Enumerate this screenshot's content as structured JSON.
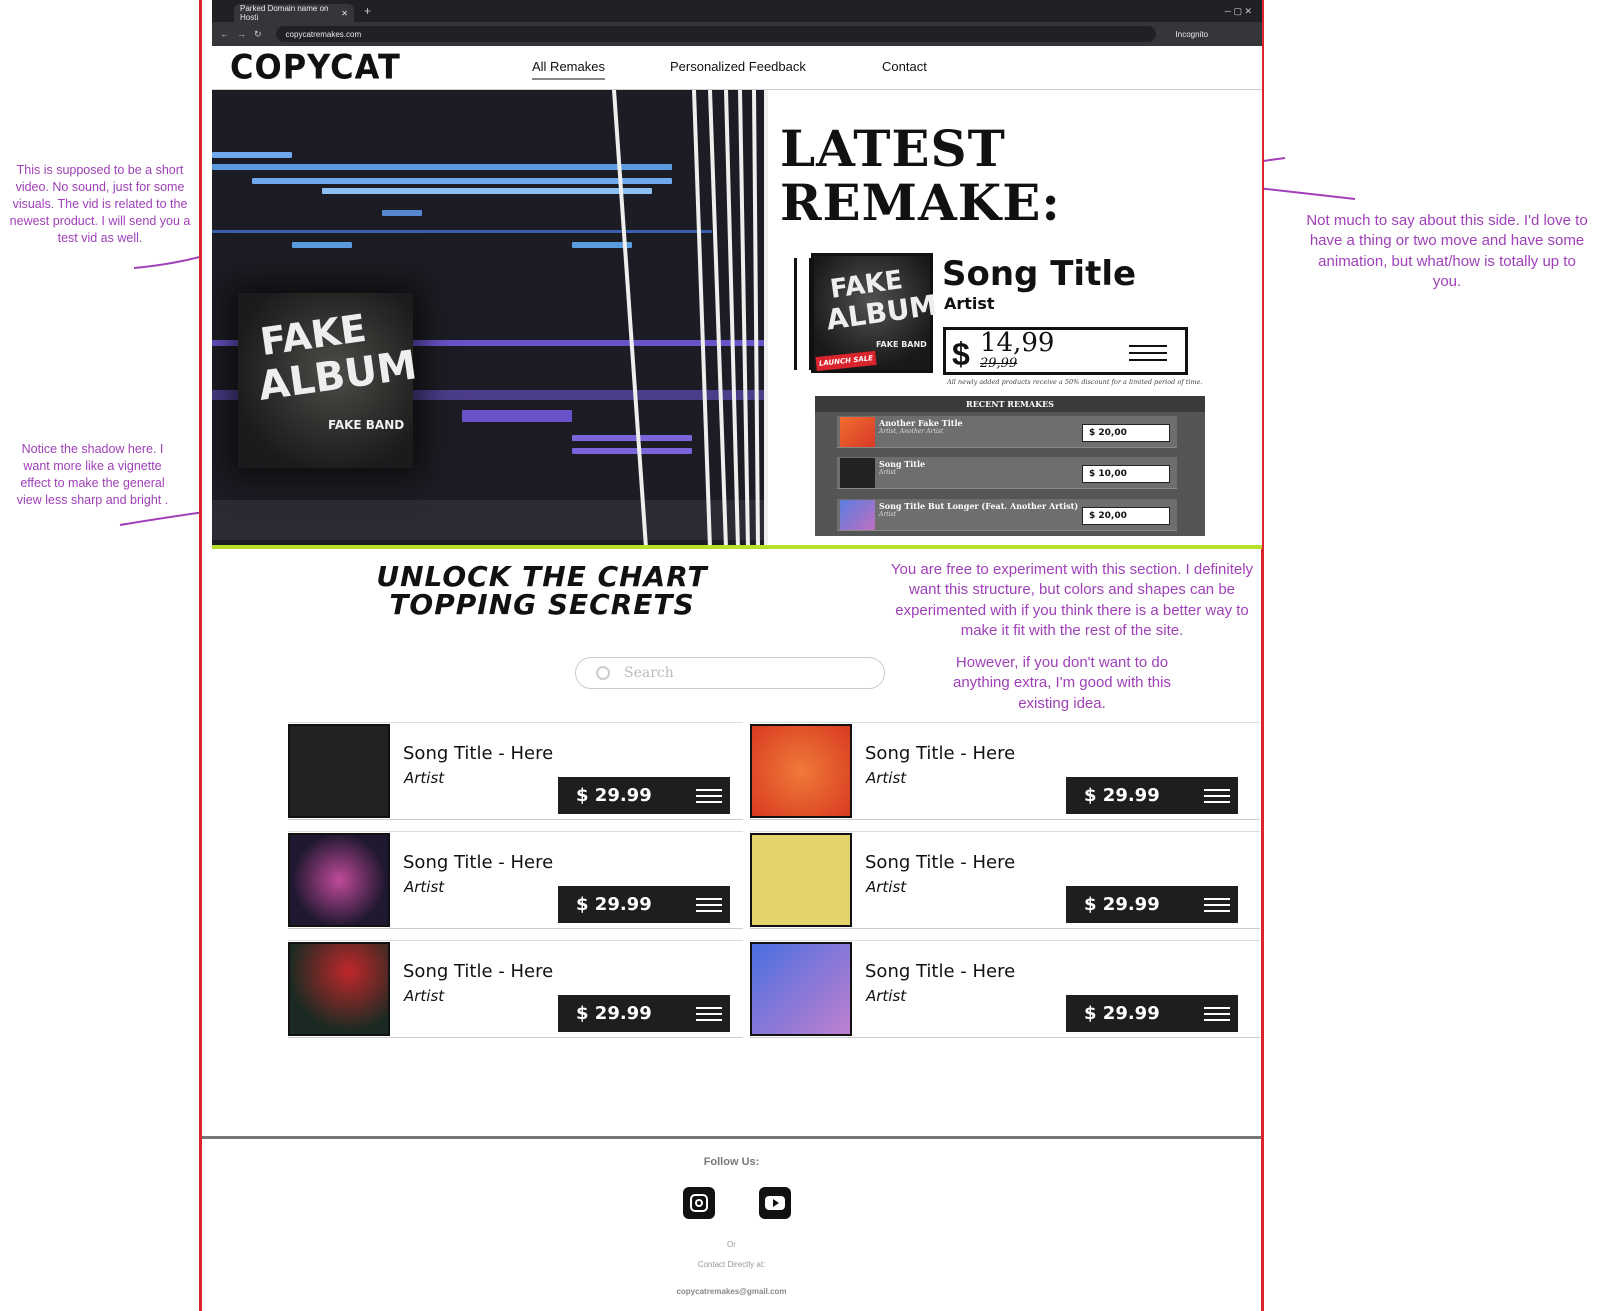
{
  "browser": {
    "tab_title": "Parked Domain name on Hosti",
    "url": "copycatremakes.com",
    "incognito_label": "Incognito"
  },
  "nav": {
    "logo": "COPYCAT",
    "links": [
      "All Remakes",
      "Personalized Feedback",
      "Contact"
    ]
  },
  "hero": {
    "heading_line1": "LATEST",
    "heading_line2": "REMAKE:",
    "featured": {
      "title": "Song Title",
      "artist": "Artist",
      "price": "14,99",
      "old_price": "29,99",
      "currency": "$",
      "cover_text_1": "FAKE",
      "cover_text_2": "ALBUM",
      "cover_band": "FAKE BAND",
      "sale_tag": "LAUNCH SALE",
      "discount_note": "All newly added products receive a 50% discount for a limited period of time."
    },
    "recent_header": "RECENT REMAKES",
    "recent": [
      {
        "title": "Another Fake Title",
        "artist": "Artist, Another Artist",
        "price": "$ 20,00",
        "thumb_color": "#e84a2a"
      },
      {
        "title": "Song Title",
        "artist": "Artist",
        "price": "$ 10,00",
        "thumb_color": "#222222"
      },
      {
        "title": "Song Title But Longer (Feat. Another Artist)",
        "artist": "Artist",
        "price": "$ 20,00",
        "thumb_color": "#6a7fd8"
      }
    ]
  },
  "catalog": {
    "heading_line1": "UNLOCK THE CHART",
    "heading_line2": "TOPPING SECRETS",
    "search_placeholder": "Search",
    "items": [
      {
        "title": "Song Title - Here",
        "artist": "Artist",
        "price": "$ 29.99"
      },
      {
        "title": "Song Title - Here",
        "artist": "Artist",
        "price": "$ 29.99"
      },
      {
        "title": "Song Title - Here",
        "artist": "Artist",
        "price": "$ 29.99"
      },
      {
        "title": "Song Title - Here",
        "artist": "Artist",
        "price": "$ 29.99"
      },
      {
        "title": "Song Title - Here",
        "artist": "Artist",
        "price": "$ 29.99"
      },
      {
        "title": "Song Title - Here",
        "artist": "Artist",
        "price": "$ 29.99"
      }
    ]
  },
  "footer": {
    "follow": "Follow Us:",
    "or": "Or",
    "contact_label": "Contact Directly at:",
    "email": "copycatremakes@gmail.com"
  },
  "annotations": {
    "video_note": "This is supposed to be a short video. No sound, just for some visuals. The vid is related to the newest product. I will send you a test vid as well.",
    "shadow_note": "Notice the shadow here. I want more like a vignette effect to make the general view less sharp and bright .",
    "right_note": "Not much to say about this side. I'd love to have a thing or two move and have some animation, but what/how is totally up to you.",
    "section_note": "You are free to experiment with this section. I definitely want this structure, but colors and shapes can be experimented with if you think there is a better way to make it fit with the rest of the site.",
    "section_note_2": "However, if you don't want to do anything extra, I'm good with this existing idea."
  },
  "colors": {
    "frame": "#d9232d",
    "annotation": "#a040b8",
    "accent_green": "#b8e02a"
  }
}
